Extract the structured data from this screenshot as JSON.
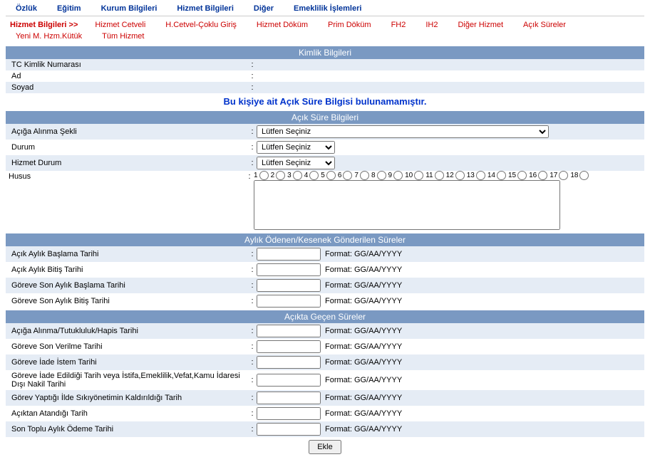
{
  "tabs": {
    "ozluk": "Özlük",
    "egitim": "Eğitim",
    "kurum": "Kurum Bilgileri",
    "hizmet": "Hizmet Bilgileri",
    "diger": "Diğer",
    "emeklilik": "Emeklilik İşlemleri"
  },
  "subtabs": {
    "prefix": "Hizmet Bilgileri >>",
    "cetvel": "Hizmet Cetveli",
    "coklu": "H.Cetvel-Çoklu Giriş",
    "dokum": "Hizmet Döküm",
    "prim": "Prim Döküm",
    "fh2": "FH2",
    "ih2": "IH2",
    "dhizmet": "Diğer Hizmet",
    "acik": "Açık Süreler",
    "yeni": "Yeni M. Hzm.Kütük",
    "tum": "Tüm Hizmet"
  },
  "sections": {
    "kimlik": "Kimlik Bilgileri",
    "acik": "Açık Süre Bilgileri",
    "aylik": "Aylık Ödenen/Kesenek Gönderilen Süreler",
    "gecen": "Açıkta Geçen Süreler"
  },
  "kimlik": {
    "tc_label": "TC Kimlik Numarası",
    "ad_label": "Ad",
    "soyad_label": "Soyad",
    "tc_value": "",
    "ad_value": "",
    "soyad_value": ""
  },
  "warning": "Bu kişiye ait Açık Süre Bilgisi bulunamamıştır.",
  "acik": {
    "sekil_label": "Açığa Alınma Şekli",
    "durum_label": "Durum",
    "hdurum_label": "Hizmet Durum",
    "husus_label": "Husus",
    "placeholder": "Lütfen Seçiniz"
  },
  "radios": [
    "1",
    "2",
    "3",
    "4",
    "5",
    "6",
    "7",
    "8",
    "9",
    "10",
    "11",
    "12",
    "13",
    "14",
    "15",
    "16",
    "17",
    "18"
  ],
  "aylik": {
    "baslama": "Açık Aylık Başlama Tarihi",
    "bitis": "Açık Aylık Bitiş Tarihi",
    "gson_baslama": "Göreve Son Aylık Başlama Tarihi",
    "gson_bitis": "Göreve Son Aylık Bitiş Tarihi"
  },
  "gecen": {
    "tutukluluk": "Açığa Alınma/Tutukluluk/Hapis Tarihi",
    "gson_verilme": "Göreve Son Verilme Tarihi",
    "iade_istem": "Göreve İade İstem Tarihi",
    "iade_edildi": "Göreve İade Edildiği Tarih veya İstifa,Emeklilik,Vefat,Kamu İdaresi Dışı Nakil Tarihi",
    "sikiyonetim": "Görev Yaptığı İlde Sıkıyönetimin Kaldırıldığı Tarih",
    "atandigi": "Açıktan Atandığı Tarih",
    "sontoplu": "Son Toplu Aylık Ödeme Tarihi"
  },
  "format_hint": "Format: GG/AA/YYYY",
  "buttons": {
    "ekle": "Ekle"
  }
}
